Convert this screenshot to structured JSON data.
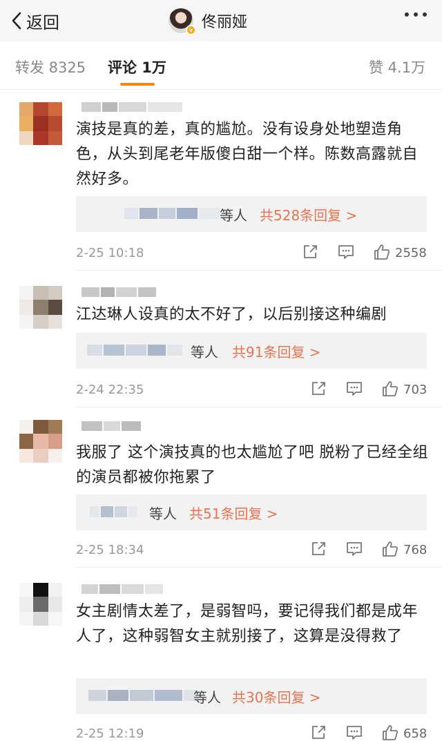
{
  "nav": {
    "back_label": "返回",
    "title": "佟丽娅"
  },
  "tabs": {
    "repost": "转发 8325",
    "comments": "评论 1万",
    "likes": "赞 4.1万"
  },
  "colors": {
    "accent": "#ff8200",
    "reply_link": "#eb7350",
    "verified_badge": "#f5a623"
  },
  "icons": {
    "back": "chevron-left-icon",
    "more": "more-dots-icon",
    "share": "share-icon",
    "reply": "comment-icon",
    "like": "thumb-up-icon"
  },
  "comments": [
    {
      "text": "演技是真的差，真的尴尬。没有设身处地塑造角色，从头到尾老年版傻白甜一个样。陈数高露就自然好多。",
      "reply_who": "等人",
      "reply_count": "共528条回复 >",
      "time": "2-25 10:18",
      "likes": "2558"
    },
    {
      "text": "江达琳人设真的太不好了，以后别接这种编剧",
      "reply_who": "等人",
      "reply_count": "共91条回复 >",
      "time": "2-24 22:35",
      "likes": "703"
    },
    {
      "text": "我服了 这个演技真的也太尴尬了吧 脱粉了已经全组的演员都被你拖累了",
      "reply_who": "等人",
      "reply_count": "共51条回复 >",
      "time": "2-25 18:34",
      "likes": "768"
    },
    {
      "text": "女主剧情太差了，是弱智吗，要记得我们都是成年人了，这种弱智女主就别接了，这算是没得救了",
      "reply_who": "等人",
      "reply_count": "共30条回复 >",
      "time": "2-25 12:19",
      "likes": "658"
    }
  ]
}
